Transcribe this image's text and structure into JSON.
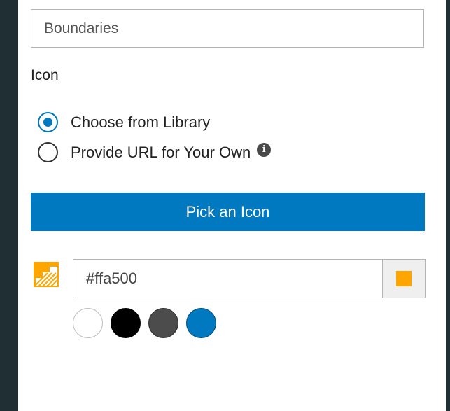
{
  "layer_name": {
    "value": "Boundaries"
  },
  "icon_section": {
    "label": "Icon",
    "options": [
      {
        "label": "Choose from Library",
        "selected": true
      },
      {
        "label": "Provide URL for Your Own",
        "selected": false
      }
    ],
    "info_icon": "info-icon",
    "pick_button_label": "Pick an Icon"
  },
  "color": {
    "hex_value": "#ffa500",
    "current_color": "#ffa500",
    "presets": [
      {
        "name": "white",
        "color": "#ffffff",
        "border": "#bdbdbd"
      },
      {
        "name": "black",
        "color": "#000000",
        "border": "#000000"
      },
      {
        "name": "dark-gray",
        "color": "#4c4c4c",
        "border": "#2b2b2b"
      },
      {
        "name": "blue",
        "color": "#0079c1",
        "border": "#004a78"
      }
    ]
  },
  "theme": {
    "accent": "#0079c1",
    "rail": "#1f2f33"
  }
}
